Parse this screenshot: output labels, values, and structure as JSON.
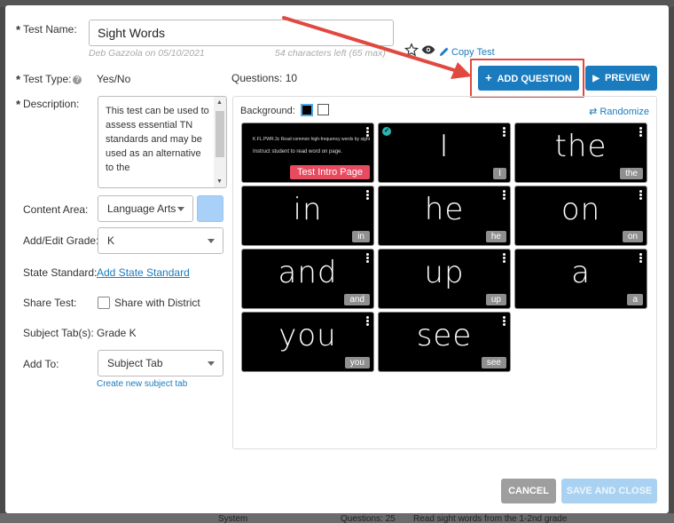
{
  "backdrop": {
    "bottom_left": "System",
    "bottom_mid": "Questions: 25",
    "bottom_right": "Read sight words from the 1-2nd grade"
  },
  "form": {
    "test_name_label": "Test Name:",
    "test_name_value": "Sight Words",
    "author_meta": "Deb Gazzola on 05/10/2021",
    "chars_left": "54 characters left (65 max)",
    "copy_test": "Copy Test",
    "test_type_label": "Test Type:",
    "test_type_value": "Yes/No",
    "description_label": "Description:",
    "description_value": "This test can be used to assess essential TN standards and may be used as an alternative to the",
    "content_area_label": "Content Area:",
    "content_area_value": "Language Arts",
    "grade_label": "Add/Edit Grade:",
    "grade_value": "K",
    "state_standard_label": "State Standard:",
    "state_standard_link": "Add State Standard",
    "share_label": "Share Test:",
    "share_option": "Share with District",
    "subject_tabs_label": "Subject Tab(s):",
    "subject_tabs_value": "Grade K",
    "add_to_label": "Add To:",
    "add_to_value": "Subject Tab",
    "create_subject_tab": "Create new subject tab"
  },
  "questions": {
    "count_label": "Questions: 10",
    "add_button": "ADD QUESTION",
    "preview_button": "PREVIEW",
    "background_label": "Background:",
    "randomize": "Randomize",
    "intro_card": {
      "line1": "K.FL.PWR.3c Read common high-frequency words by sight",
      "line2": "Instruct student to read word on page.",
      "tag": "Test Intro Page"
    },
    "cards": [
      {
        "word": "I",
        "tag": "I"
      },
      {
        "word": "the",
        "tag": "the"
      },
      {
        "word": "in",
        "tag": "in"
      },
      {
        "word": "he",
        "tag": "he"
      },
      {
        "word": "on",
        "tag": "on"
      },
      {
        "word": "and",
        "tag": "and"
      },
      {
        "word": "up",
        "tag": "up"
      },
      {
        "word": "a",
        "tag": "a"
      },
      {
        "word": "you",
        "tag": "you"
      },
      {
        "word": "see",
        "tag": "see"
      }
    ]
  },
  "footer": {
    "cancel": "CANCEL",
    "save_close": "SAVE AND CLOSE"
  },
  "colors": {
    "accent": "#1a7bbf",
    "highlight": "#e0493f",
    "intro_tag": "#e84a5f",
    "swatch": "#a8d0f8"
  }
}
